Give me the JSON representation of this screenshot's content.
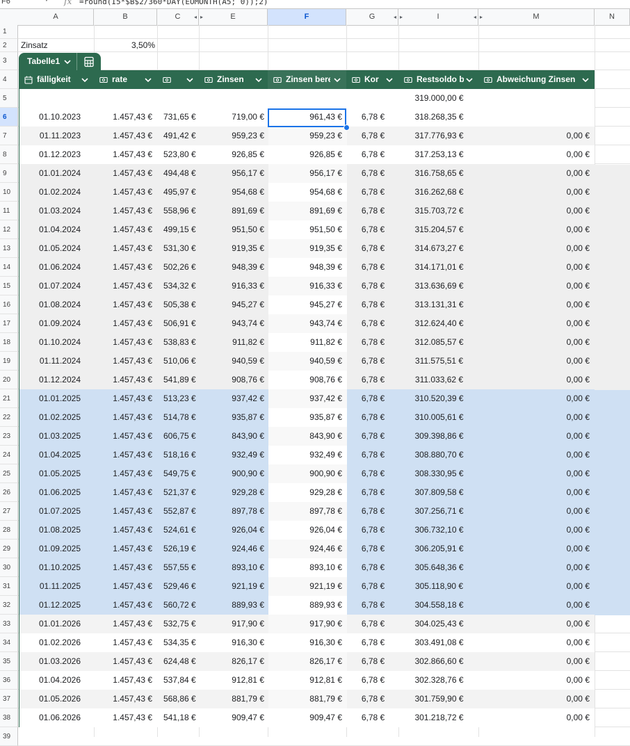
{
  "formula_bar": {
    "cell_ref": "F6",
    "formula": "=round(I5*$B$2/360*DAY(EOMONTH(A5; 0));2)"
  },
  "columns": [
    "A",
    "B",
    "C",
    "E",
    "F",
    "G",
    "I",
    "M",
    "N"
  ],
  "row_numbers": [
    "1",
    "2",
    "3",
    "4",
    "5",
    "6",
    "7",
    "8",
    "9",
    "10",
    "11",
    "12",
    "13",
    "14",
    "15",
    "16",
    "17",
    "18",
    "19",
    "20",
    "21",
    "22",
    "23",
    "24",
    "25",
    "26",
    "27",
    "28",
    "29",
    "30",
    "31",
    "32",
    "33",
    "34",
    "35",
    "36",
    "37",
    "38",
    "39"
  ],
  "cells": {
    "a2": "Zinsatz",
    "b2": "3,50%"
  },
  "table": {
    "name": "Tabelle1",
    "headers": {
      "faelligkeit": "fälligkeit",
      "rate": "rate",
      "c": "",
      "zinsen": "Zinsen",
      "zinsen_ber": "Zinsen bere",
      "kor": "Kor",
      "restsoldo": "Restsoldo b",
      "abweichung": "Abweichung Zinsen"
    },
    "initial_restsoldo": "319.000,00 €",
    "rows": [
      [
        "01.10.2023",
        "1.457,43 €",
        "731,65 €",
        "719,00 €",
        "961,43 €",
        "6,78 €",
        "318.268,35 €",
        ""
      ],
      [
        "01.11.2023",
        "1.457,43 €",
        "491,42 €",
        "959,23 €",
        "959,23 €",
        "6,78 €",
        "317.776,93 €",
        "0,00 €"
      ],
      [
        "01.12.2023",
        "1.457,43 €",
        "523,80 €",
        "926,85 €",
        "926,85 €",
        "6,78 €",
        "317.253,13 €",
        "0,00 €"
      ],
      [
        "01.01.2024",
        "1.457,43 €",
        "494,48 €",
        "956,17 €",
        "956,17 €",
        "6,78 €",
        "316.758,65 €",
        "0,00 €"
      ],
      [
        "01.02.2024",
        "1.457,43 €",
        "495,97 €",
        "954,68 €",
        "954,68 €",
        "6,78 €",
        "316.262,68 €",
        "0,00 €"
      ],
      [
        "01.03.2024",
        "1.457,43 €",
        "558,96 €",
        "891,69 €",
        "891,69 €",
        "6,78 €",
        "315.703,72 €",
        "0,00 €"
      ],
      [
        "01.04.2024",
        "1.457,43 €",
        "499,15 €",
        "951,50 €",
        "951,50 €",
        "6,78 €",
        "315.204,57 €",
        "0,00 €"
      ],
      [
        "01.05.2024",
        "1.457,43 €",
        "531,30 €",
        "919,35 €",
        "919,35 €",
        "6,78 €",
        "314.673,27 €",
        "0,00 €"
      ],
      [
        "01.06.2024",
        "1.457,43 €",
        "502,26 €",
        "948,39 €",
        "948,39 €",
        "6,78 €",
        "314.171,01 €",
        "0,00 €"
      ],
      [
        "01.07.2024",
        "1.457,43 €",
        "534,32 €",
        "916,33 €",
        "916,33 €",
        "6,78 €",
        "313.636,69 €",
        "0,00 €"
      ],
      [
        "01.08.2024",
        "1.457,43 €",
        "505,38 €",
        "945,27 €",
        "945,27 €",
        "6,78 €",
        "313.131,31 €",
        "0,00 €"
      ],
      [
        "01.09.2024",
        "1.457,43 €",
        "506,91 €",
        "943,74 €",
        "943,74 €",
        "6,78 €",
        "312.624,40 €",
        "0,00 €"
      ],
      [
        "01.10.2024",
        "1.457,43 €",
        "538,83 €",
        "911,82 €",
        "911,82 €",
        "6,78 €",
        "312.085,57 €",
        "0,00 €"
      ],
      [
        "01.11.2024",
        "1.457,43 €",
        "510,06 €",
        "940,59 €",
        "940,59 €",
        "6,78 €",
        "311.575,51 €",
        "0,00 €"
      ],
      [
        "01.12.2024",
        "1.457,43 €",
        "541,89 €",
        "908,76 €",
        "908,76 €",
        "6,78 €",
        "311.033,62 €",
        "0,00 €"
      ],
      [
        "01.01.2025",
        "1.457,43 €",
        "513,23 €",
        "937,42 €",
        "937,42 €",
        "6,78 €",
        "310.520,39 €",
        "0,00 €"
      ],
      [
        "01.02.2025",
        "1.457,43 €",
        "514,78 €",
        "935,87 €",
        "935,87 €",
        "6,78 €",
        "310.005,61 €",
        "0,00 €"
      ],
      [
        "01.03.2025",
        "1.457,43 €",
        "606,75 €",
        "843,90 €",
        "843,90 €",
        "6,78 €",
        "309.398,86 €",
        "0,00 €"
      ],
      [
        "01.04.2025",
        "1.457,43 €",
        "518,16 €",
        "932,49 €",
        "932,49 €",
        "6,78 €",
        "308.880,70 €",
        "0,00 €"
      ],
      [
        "01.05.2025",
        "1.457,43 €",
        "549,75 €",
        "900,90 €",
        "900,90 €",
        "6,78 €",
        "308.330,95 €",
        "0,00 €"
      ],
      [
        "01.06.2025",
        "1.457,43 €",
        "521,37 €",
        "929,28 €",
        "929,28 €",
        "6,78 €",
        "307.809,58 €",
        "0,00 €"
      ],
      [
        "01.07.2025",
        "1.457,43 €",
        "552,87 €",
        "897,78 €",
        "897,78 €",
        "6,78 €",
        "307.256,71 €",
        "0,00 €"
      ],
      [
        "01.08.2025",
        "1.457,43 €",
        "524,61 €",
        "926,04 €",
        "926,04 €",
        "6,78 €",
        "306.732,10 €",
        "0,00 €"
      ],
      [
        "01.09.2025",
        "1.457,43 €",
        "526,19 €",
        "924,46 €",
        "924,46 €",
        "6,78 €",
        "306.205,91 €",
        "0,00 €"
      ],
      [
        "01.10.2025",
        "1.457,43 €",
        "557,55 €",
        "893,10 €",
        "893,10 €",
        "6,78 €",
        "305.648,36 €",
        "0,00 €"
      ],
      [
        "01.11.2025",
        "1.457,43 €",
        "529,46 €",
        "921,19 €",
        "921,19 €",
        "6,78 €",
        "305.118,90 €",
        "0,00 €"
      ],
      [
        "01.12.2025",
        "1.457,43 €",
        "560,72 €",
        "889,93 €",
        "889,93 €",
        "6,78 €",
        "304.558,18 €",
        "0,00 €"
      ],
      [
        "01.01.2026",
        "1.457,43 €",
        "532,75 €",
        "917,90 €",
        "917,90 €",
        "6,78 €",
        "304.025,43 €",
        "0,00 €"
      ],
      [
        "01.02.2026",
        "1.457,43 €",
        "534,35 €",
        "916,30 €",
        "916,30 €",
        "6,78 €",
        "303.491,08 €",
        "0,00 €"
      ],
      [
        "01.03.2026",
        "1.457,43 €",
        "624,48 €",
        "826,17 €",
        "826,17 €",
        "6,78 €",
        "302.866,60 €",
        "0,00 €"
      ],
      [
        "01.04.2026",
        "1.457,43 €",
        "537,84 €",
        "912,81 €",
        "912,81 €",
        "6,78 €",
        "302.328,76 €",
        "0,00 €"
      ],
      [
        "01.05.2026",
        "1.457,43 €",
        "568,86 €",
        "881,79 €",
        "881,79 €",
        "6,78 €",
        "301.759,90 €",
        "0,00 €"
      ],
      [
        "01.06.2026",
        "1.457,43 €",
        "541,18 €",
        "909,47 €",
        "909,47 €",
        "6,78 €",
        "301.218,72 €",
        "0,00 €"
      ]
    ]
  },
  "colors": {
    "table_header": "#2d6a4f",
    "highlight_2025": "#cfe0f3",
    "highlight_2024": "#efefef",
    "selection": "#1a73e8"
  }
}
